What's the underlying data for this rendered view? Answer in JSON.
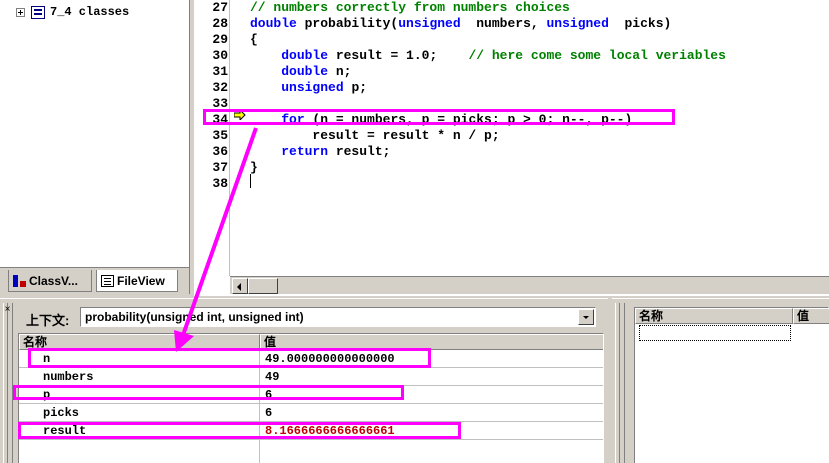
{
  "class_view": {
    "tree_item": "7_4 classes",
    "tabs": [
      "ClassV...",
      "FileView"
    ]
  },
  "editor": {
    "lines": [
      {
        "num": "27",
        "segments": [
          {
            "t": "// numbers correctly from numbers choices",
            "c": "cm"
          }
        ]
      },
      {
        "num": "28",
        "segments": [
          {
            "t": "double",
            "c": "kw"
          },
          {
            "t": " probability(",
            "c": ""
          },
          {
            "t": "unsigned",
            "c": "kw"
          },
          {
            "t": "  numbers, ",
            "c": ""
          },
          {
            "t": "unsigned",
            "c": "kw"
          },
          {
            "t": "  picks)",
            "c": ""
          }
        ]
      },
      {
        "num": "29",
        "segments": [
          {
            "t": "{",
            "c": ""
          }
        ]
      },
      {
        "num": "30",
        "segments": [
          {
            "t": "    ",
            "c": ""
          },
          {
            "t": "double",
            "c": "kw"
          },
          {
            "t": " result = 1.0;    ",
            "c": ""
          },
          {
            "t": "// here come some local veriables",
            "c": "cm"
          }
        ]
      },
      {
        "num": "31",
        "segments": [
          {
            "t": "    ",
            "c": ""
          },
          {
            "t": "double",
            "c": "kw"
          },
          {
            "t": " n;",
            "c": ""
          }
        ]
      },
      {
        "num": "32",
        "segments": [
          {
            "t": "    ",
            "c": ""
          },
          {
            "t": "unsigned",
            "c": "kw"
          },
          {
            "t": " p;",
            "c": ""
          }
        ]
      },
      {
        "num": "33",
        "segments": [
          {
            "t": "",
            "c": ""
          }
        ]
      },
      {
        "num": "34",
        "segments": [
          {
            "t": "    ",
            "c": ""
          },
          {
            "t": "for",
            "c": "kw"
          },
          {
            "t": " (n = numbers, p = picks; p > 0; n--, p--)",
            "c": ""
          }
        ]
      },
      {
        "num": "35",
        "segments": [
          {
            "t": "        result = result * n / p;",
            "c": ""
          }
        ]
      },
      {
        "num": "36",
        "segments": [
          {
            "t": "    ",
            "c": ""
          },
          {
            "t": "return",
            "c": "kw"
          },
          {
            "t": " result;",
            "c": ""
          }
        ]
      },
      {
        "num": "37",
        "segments": [
          {
            "t": "}",
            "c": ""
          }
        ]
      },
      {
        "num": "38",
        "segments": [
          {
            "t": "",
            "c": ""
          }
        ]
      }
    ]
  },
  "variables": {
    "context_label": "上下文:",
    "context_value": "probability(unsigned int, unsigned int)",
    "col_name": "名称",
    "col_value": "值",
    "rows": [
      {
        "name": "n",
        "value": "49.000000000000000",
        "changed": false
      },
      {
        "name": "numbers",
        "value": "49",
        "changed": false
      },
      {
        "name": "p",
        "value": "6",
        "changed": false
      },
      {
        "name": "picks",
        "value": "6",
        "changed": false
      },
      {
        "name": "result",
        "value": "8.1666666666666661",
        "changed": true
      }
    ],
    "changed_color": "#c00000"
  },
  "watch": {
    "col_name": "名称",
    "col_value": "值"
  },
  "colors": {
    "keyword": "#0000ff",
    "comment": "#008000",
    "annotation": "#ff00ff"
  }
}
